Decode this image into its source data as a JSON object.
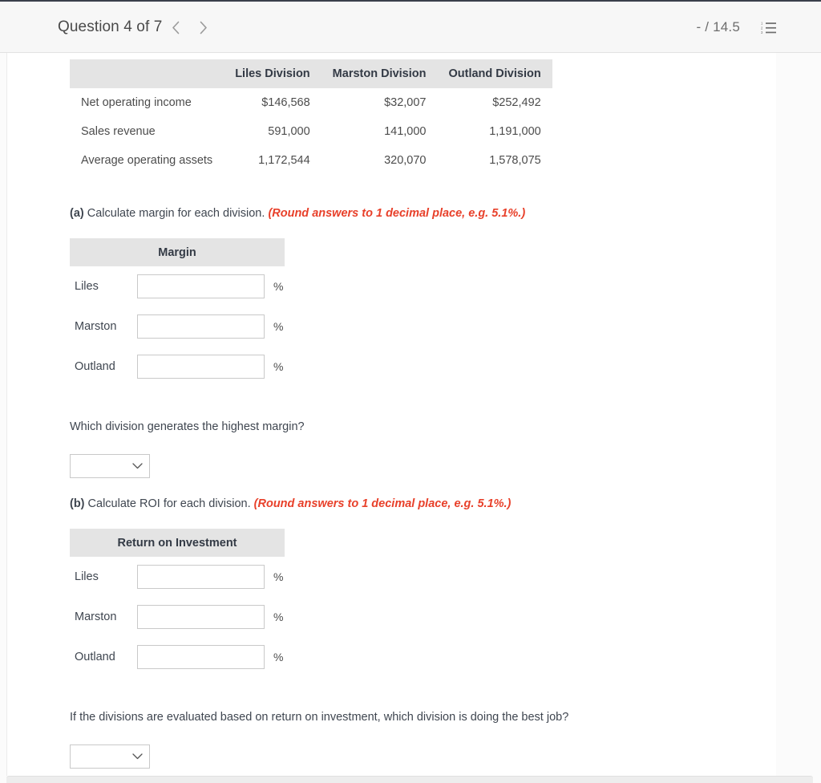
{
  "header": {
    "question_label": "Question 4 of 7",
    "prev_icon": "chevron-left-icon",
    "next_icon": "chevron-right-icon",
    "score": "- / 14.5",
    "list_icon": "numbered-list-icon"
  },
  "data_table": {
    "columns": [
      "",
      "Liles Division",
      "Marston Division",
      "Outland Division"
    ],
    "rows": [
      {
        "label": "Net operating income",
        "values": [
          "$146,568",
          "$32,007",
          "$252,492"
        ]
      },
      {
        "label": "Sales revenue",
        "values": [
          "591,000",
          "141,000",
          "1,191,000"
        ]
      },
      {
        "label": "Average operating assets",
        "values": [
          "1,172,544",
          "320,070",
          "1,578,075"
        ]
      }
    ]
  },
  "part_a": {
    "marker": "(a)",
    "text": "Calculate margin for each division.",
    "hint": "(Round answers to 1 decimal place, e.g. 5.1%.)",
    "table_header": "Margin",
    "rows": [
      {
        "label": "Liles",
        "value": "",
        "unit": "%"
      },
      {
        "label": "Marston",
        "value": "",
        "unit": "%"
      },
      {
        "label": "Outland",
        "value": "",
        "unit": "%"
      }
    ],
    "follow_up": "Which division generates the highest margin?",
    "dropdown_value": "",
    "dropdown_icon": "chevron-down-icon"
  },
  "part_b": {
    "marker": "(b)",
    "text": "Calculate ROI for each division.",
    "hint": "(Round answers to 1 decimal place, e.g. 5.1%.)",
    "table_header": "Return on Investment",
    "rows": [
      {
        "label": "Liles",
        "value": "",
        "unit": "%"
      },
      {
        "label": "Marston",
        "value": "",
        "unit": "%"
      },
      {
        "label": "Outland",
        "value": "",
        "unit": "%"
      }
    ],
    "follow_up": "If the divisions are evaluated based on return on investment, which division is doing the best job?",
    "dropdown_value": "",
    "dropdown_icon": "chevron-down-icon"
  }
}
